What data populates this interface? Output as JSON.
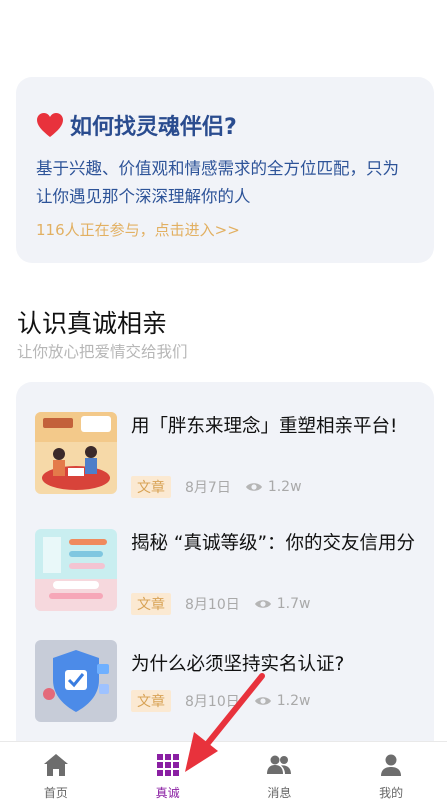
{
  "promo": {
    "title": "如何找灵魂伴侣?",
    "description": "基于兴趣、价值观和情感需求的全方位匹配，只为让你遇见那个深深理解你的人",
    "link": "116人正在参与，点击进入>>"
  },
  "section": {
    "title": "认识真诚相亲",
    "subtitle": "让你放心把爱情交给我们"
  },
  "articles": [
    {
      "title": "用「胖东来理念」重塑相亲平台!",
      "tag": "文章",
      "date": "8月7日",
      "views": "1.2w"
    },
    {
      "title": "揭秘 “真诚等级”：你的交友信用分",
      "tag": "文章",
      "date": "8月10日",
      "views": "1.7w"
    },
    {
      "title": "为什么必须坚持实名认证?",
      "tag": "文章",
      "date": "8月10日",
      "views": "1.2w"
    }
  ],
  "tabs": [
    {
      "label": "首页",
      "icon": "home-icon"
    },
    {
      "label": "真诚",
      "icon": "grid-icon",
      "active": true
    },
    {
      "label": "消息",
      "icon": "people-icon"
    },
    {
      "label": "我的",
      "icon": "user-icon"
    }
  ],
  "colors": {
    "accent": "#8a1fa3",
    "promo_title": "#2a4c8f",
    "link": "#e2b062",
    "arrow": "#e8323c"
  }
}
